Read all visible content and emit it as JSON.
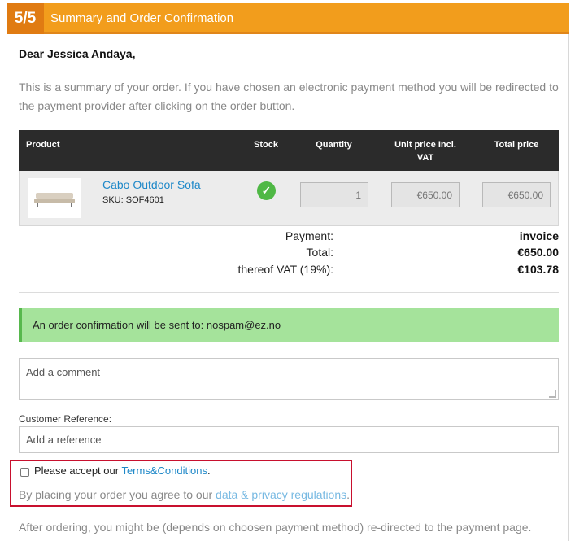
{
  "header": {
    "step": "5/5",
    "title": "Summary and Order Confirmation"
  },
  "greeting": "Dear Jessica Andaya,",
  "intro": "This is a summary of your order. If you have chosen an electronic payment method you will be redirected to the payment provider after clicking on the order button.",
  "table": {
    "columns": {
      "product": "Product",
      "stock": "Stock",
      "quantity": "Quantity",
      "unit_price": "Unit price Incl. VAT",
      "total": "Total price"
    },
    "rows": [
      {
        "name": "Cabo Outdoor Sofa",
        "sku": "SKU: SOF4601",
        "stock_icon": "check-circle-icon",
        "quantity": "1",
        "unit_price": "€650.00",
        "total": "€650.00"
      }
    ]
  },
  "summary": {
    "payment_label": "Payment:",
    "payment_value": "invoice",
    "total_label": "Total:",
    "total_value": "€650.00",
    "vat_label": "thereof VAT (19%):",
    "vat_value": "€103.78"
  },
  "notice": "An order confirmation will be sent to: nospam@ez.no",
  "comment": {
    "placeholder": "Add a comment"
  },
  "reference": {
    "label": "Customer Reference:",
    "placeholder": "Add a reference"
  },
  "terms": {
    "prefix": "Please accept our ",
    "link": "Terms&Conditions",
    "suffix": ".",
    "privacy_prefix": "By placing your order you agree to our ",
    "privacy_link": "data & privacy regulations",
    "privacy_suffix": "."
  },
  "after_text": "After ordering, you might be (depends on choosen payment method) re-directed to the payment page.",
  "colors": {
    "accent": "#f29d1c",
    "step_bg": "#e07b12",
    "link": "#1e88c8",
    "notice_bg": "#a5e39b",
    "highlight_border": "#c8102e"
  }
}
